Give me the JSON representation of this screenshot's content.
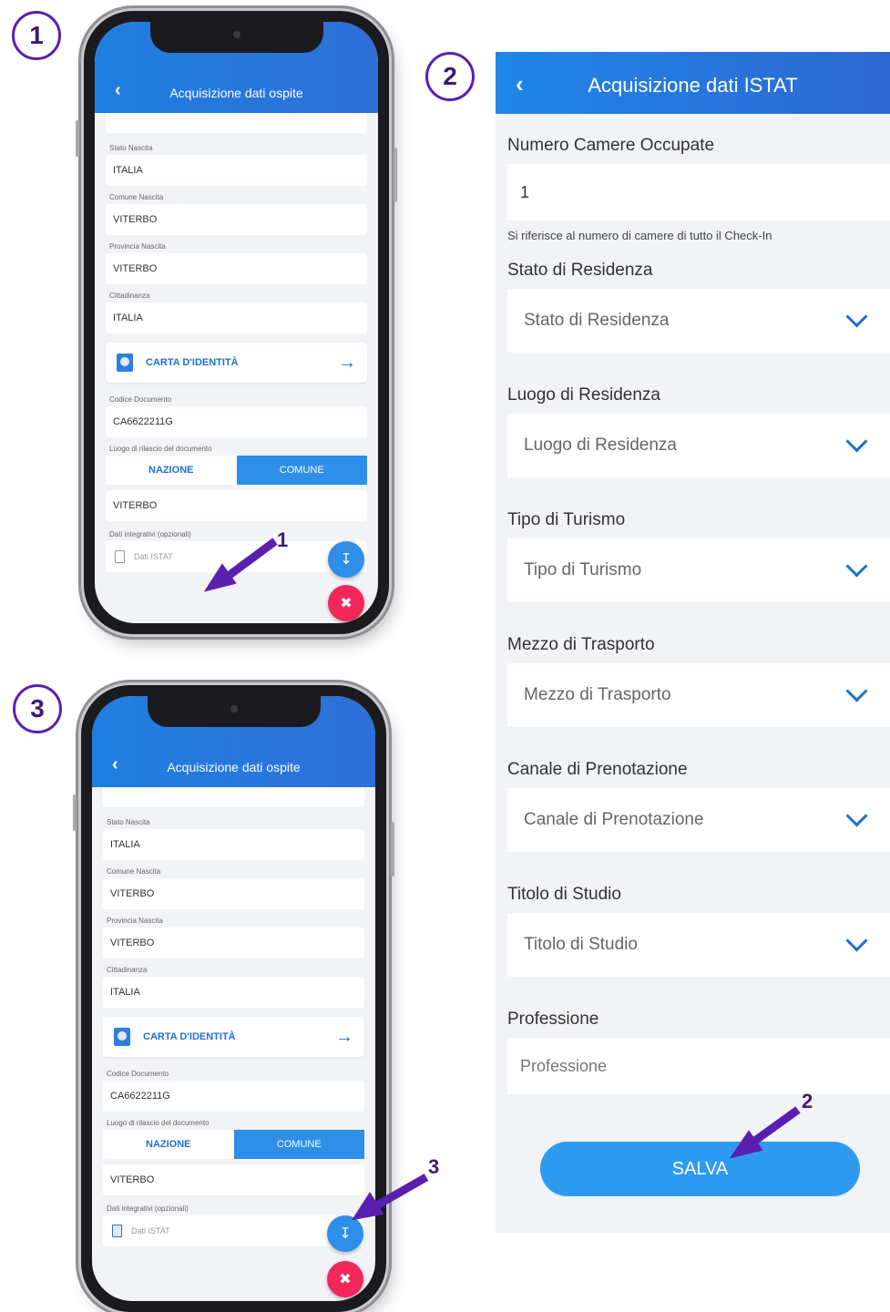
{
  "steps": {
    "one": "1",
    "two": "2",
    "three": "3"
  },
  "arrow_numbers": {
    "a1": "1",
    "a2": "2",
    "a3": "3"
  },
  "guest_screen": {
    "title": "Acquisizione dati ospite",
    "fields": [
      {
        "label": "Stato Nascita",
        "value": "ITALIA"
      },
      {
        "label": "Comune Nascita",
        "value": "VITERBO"
      },
      {
        "label": "Provincia Nascita",
        "value": "VITERBO"
      },
      {
        "label": "Cittadinanza",
        "value": "ITALIA"
      }
    ],
    "document_type": "CARTA D'IDENTITÀ",
    "doc_code_label": "Codice Documento",
    "doc_code_value": "CA6622211G",
    "issue_place_label": "Luogo di rilascio del documento",
    "toggle_nation": "NAZIONE",
    "toggle_comune": "COMUNE",
    "issue_place_value": "VITERBO",
    "extra_label": "Dati integrativi (opzionali)",
    "istat_label": "Dati ISTAT"
  },
  "istat_form": {
    "title": "Acquisizione dati ISTAT",
    "rooms_label": "Numero Camere Occupate",
    "rooms_value": "1",
    "rooms_hint": "Si riferisce al numero di camere di tutto il Check-In",
    "selects": [
      {
        "label": "Stato di Residenza",
        "placeholder": "Stato di Residenza"
      },
      {
        "label": "Luogo di Residenza",
        "placeholder": "Luogo di Residenza"
      },
      {
        "label": "Tipo di Turismo",
        "placeholder": "Tipo di Turismo"
      },
      {
        "label": "Mezzo di Trasporto",
        "placeholder": "Mezzo di Trasporto"
      },
      {
        "label": "Canale di Prenotazione",
        "placeholder": "Canale di Prenotazione"
      },
      {
        "label": "Titolo di Studio",
        "placeholder": "Titolo di Studio"
      }
    ],
    "profession_label": "Professione",
    "profession_placeholder": "Professione",
    "save_label": "SALVA"
  },
  "colors": {
    "accent": "#2e8ee8",
    "annotation": "#5b1fb0",
    "delete": "#f2285a"
  }
}
